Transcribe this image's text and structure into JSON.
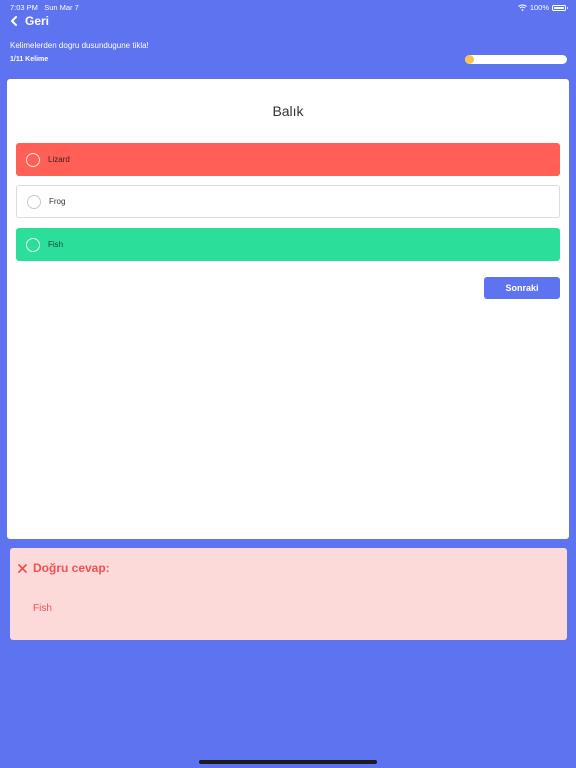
{
  "status_bar": {
    "time": "7:03 PM",
    "date": "Sun Mar 7",
    "battery": "100%"
  },
  "nav": {
    "back_label": "Geri"
  },
  "header": {
    "instruction": "Kelimelerden dogru dusundugune tikla!",
    "word_count": "1/11 Kelime",
    "progress": 0.09
  },
  "question": {
    "word": "Balık"
  },
  "options": [
    {
      "label": "Lizard",
      "state": "wrong"
    },
    {
      "label": "Frog",
      "state": "neutral"
    },
    {
      "label": "Fish",
      "state": "correct"
    }
  ],
  "next_button": {
    "label": "Sonraki"
  },
  "feedback": {
    "title": "Doğru cevap:",
    "answer": "Fish"
  },
  "colors": {
    "background": "#5e73ef",
    "wrong": "#ff5f55",
    "correct": "#2bdf9a",
    "progress_fill": "#f6c452",
    "feedback_bg": "#fddada",
    "feedback_text": "#f45050"
  }
}
